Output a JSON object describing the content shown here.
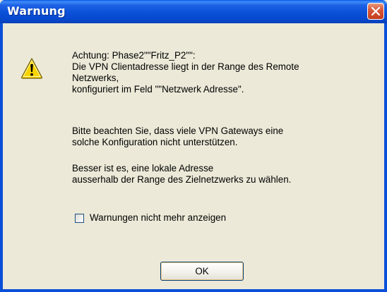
{
  "window": {
    "title": "Warnung"
  },
  "message": {
    "line1": "Achtung: Phase2\"\"Fritz_P2\"\":",
    "line2": "Die VPN Clientadresse liegt in der Range des Remote",
    "line3": "Netzwerks,",
    "line4": "konfiguriert im Feld \"\"Netzwerk Adresse\".",
    "para2_line1": "Bitte beachten Sie, dass viele VPN Gateways eine",
    "para2_line2": "solche Konfiguration nicht unterstützen.",
    "para3_line1": "Besser ist es, eine lokale Adresse",
    "para3_line2": "ausserhalb der Range des Zielnetzwerks zu wählen."
  },
  "checkbox": {
    "label": "Warnungen nicht mehr anzeigen",
    "checked": false
  },
  "buttons": {
    "ok_label": "OK"
  },
  "icons": {
    "warning": "warning-icon",
    "close": "close-icon"
  },
  "colors": {
    "titlebar": "#0a50d8",
    "dialog_background": "#ece9d8",
    "close_button": "#d9583a",
    "warning_fill": "#f7d300"
  }
}
